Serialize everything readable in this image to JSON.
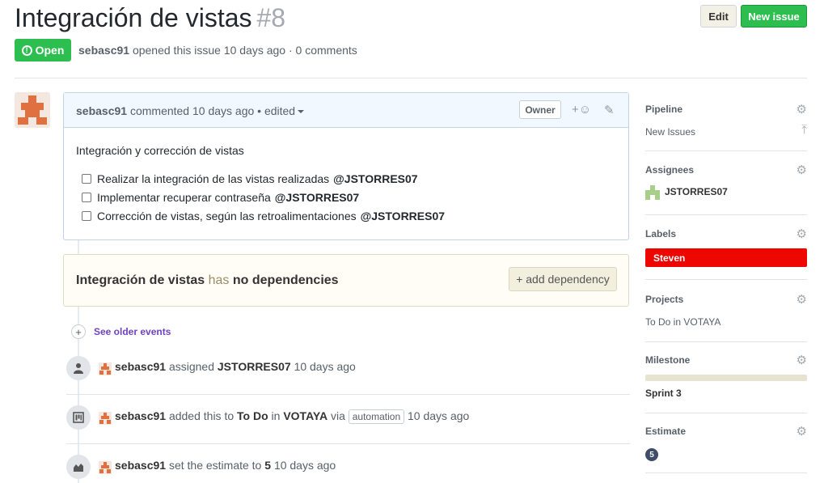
{
  "issue": {
    "title": "Integración de vistas",
    "number": "#8",
    "state": "Open",
    "author": "sebasc91",
    "meta_rest": "opened this issue 10 days ago · 0 comments"
  },
  "header_buttons": {
    "edit": "Edit",
    "new_issue": "New issue"
  },
  "comment": {
    "author": "sebasc91",
    "action": "commented 10 days ago • edited",
    "role": "Owner",
    "reaction": "+☺",
    "edit_icon": "✎",
    "body": "Integración y corrección de vistas",
    "tasks": [
      {
        "text": "Realizar la integración de las vistas realizadas",
        "mention": "@JSTORRES07"
      },
      {
        "text": "Implementar recuperar contraseña",
        "mention": "@JSTORRES07"
      },
      {
        "text": "Corrección de vistas, según las retroalimentaciones",
        "mention": "@JSTORRES07"
      }
    ]
  },
  "dependencies": {
    "issue_name": "Integración de vistas",
    "has": "has",
    "none": "no dependencies",
    "add_button": "+ add dependency"
  },
  "older_events": "See older events",
  "events": [
    {
      "icon": "person-icon",
      "actor": "sebasc91",
      "verb": "assigned",
      "target": "JSTORRES07",
      "time": "10 days ago"
    },
    {
      "icon": "project-icon",
      "actor": "sebasc91",
      "verb": "added this to",
      "target": "To Do",
      "in": "in",
      "project": "VOTAYA",
      "via": "via",
      "tag": "automation",
      "time": "10 days ago"
    },
    {
      "icon": "estimate-icon",
      "actor": "sebasc91",
      "verb": "set the estimate to",
      "target": "5",
      "time": "10 days ago"
    }
  ],
  "sidebar": {
    "pipeline": {
      "title": "Pipeline",
      "value": "New Issues"
    },
    "assignees": {
      "title": "Assignees",
      "value": "JSTORRES07"
    },
    "labels": {
      "title": "Labels",
      "value": "Steven",
      "color": "#ee0701"
    },
    "projects": {
      "title": "Projects",
      "value": "To Do in VOTAYA"
    },
    "milestone": {
      "title": "Milestone",
      "value": "Sprint 3",
      "progress": 0
    },
    "estimate": {
      "title": "Estimate",
      "value": "5"
    }
  },
  "colors": {
    "open_green": "#2cbe4e",
    "label_red": "#ee0701"
  }
}
